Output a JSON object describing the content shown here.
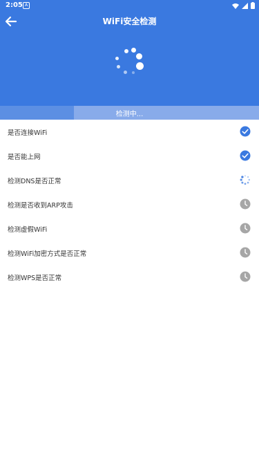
{
  "status_bar": {
    "time": "2:05",
    "app_icon": "notification-icon",
    "right_icons": [
      "wifi-icon",
      "signal-icon",
      "battery-icon"
    ]
  },
  "header": {
    "title": "WiFi安全检测",
    "back_icon": "arrow-left-icon"
  },
  "progress": {
    "label": "检测中...",
    "fraction": 0.72
  },
  "checks": [
    {
      "label": "是否连接WiFi",
      "status": "done"
    },
    {
      "label": "是否能上网",
      "status": "done"
    },
    {
      "label": "检测DNS是否正常",
      "status": "loading"
    },
    {
      "label": "检测是否收到ARP攻击",
      "status": "pending"
    },
    {
      "label": "检测虚假WiFi",
      "status": "pending"
    },
    {
      "label": "检测WiFi加密方式是否正常",
      "status": "pending"
    },
    {
      "label": "检测WPS是否正常",
      "status": "pending"
    }
  ],
  "colors": {
    "header_bg": "#3a79e0",
    "done": "#3a79e0",
    "pending": "#a6a6a6"
  }
}
